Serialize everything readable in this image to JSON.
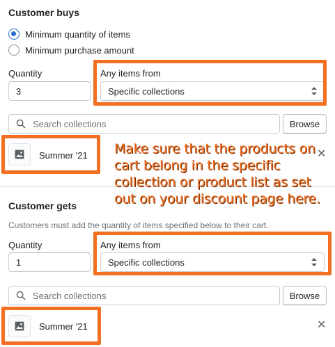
{
  "buys": {
    "title": "Customer buys",
    "options": [
      "Minimum quantity of items",
      "Minimum purchase amount"
    ],
    "selected_option": "Minimum quantity of items",
    "quantity_label": "Quantity",
    "quantity_value": "3",
    "items_from_label": "Any items from",
    "items_from_value": "Specific collections",
    "search_placeholder": "Search collections",
    "browse_label": "Browse",
    "item_title": "Summer '21"
  },
  "gets": {
    "title": "Customer gets",
    "helper": "Customers must add the quantity of items specified below to their cart.",
    "quantity_label": "Quantity",
    "quantity_value": "1",
    "items_from_label": "Any items from",
    "items_from_value": "Specific collections",
    "search_placeholder": "Search collections",
    "browse_label": "Browse",
    "item_title": "Summer '21"
  },
  "annotation": {
    "text": "Make sure that the products on cart belong in the specific collection or product list as set out on your discount page here.",
    "color": "#f36f21"
  },
  "icons": {
    "search": "search-icon",
    "image": "image-icon",
    "close": "close-icon"
  },
  "colors": {
    "accent": "#2c6ecb",
    "highlight": "#f36f21"
  }
}
